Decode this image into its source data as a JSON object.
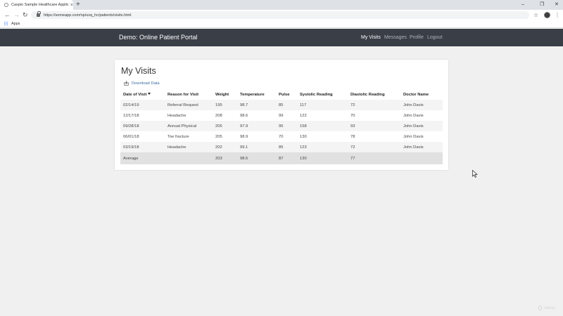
{
  "browser": {
    "tab_title": "Caspio Sample Healthcare Applic",
    "tab_close": "×",
    "new_tab": "+",
    "window_controls": [
      "–",
      "❐",
      "✕"
    ],
    "nav_back": "←",
    "nav_forward": "→",
    "nav_reload": "↻",
    "url": "https://someapp.com/np/uvq_hc/patients/visits.html",
    "bookmark_star": "☆",
    "menu": "⋮",
    "bookmarks": {
      "apps_label": "Apps"
    }
  },
  "navbar": {
    "brand": "Demo: Online Patient Portal",
    "links": [
      "My Visits",
      "Messages",
      "Profile",
      "Logout"
    ],
    "active": "My Visits"
  },
  "page": {
    "title": "My Visits",
    "download_label": "Download Data"
  },
  "table": {
    "columns": [
      "Date of Visit",
      "Reason for Visit",
      "Weight",
      "Temperature",
      "Pulse",
      "Systolic Reading",
      "Diastolic Reading",
      "Doctor Name"
    ],
    "rows": [
      [
        "02/14/19",
        "Referral Request",
        "195",
        "98.7",
        "85",
        "117",
        "72",
        "John Davis"
      ],
      [
        "12/17/18",
        "Headache",
        "208",
        "98.6",
        "99",
        "122",
        "70",
        "John Davis"
      ],
      [
        "09/28/18",
        "Annual Physical",
        "205",
        "97.9",
        "95",
        "158",
        "93",
        "John Davis"
      ],
      [
        "06/01/18",
        "Toe fracture",
        "205",
        "98.9",
        "70",
        "130",
        "78",
        "John Davis"
      ],
      [
        "03/19/18",
        "Headache",
        "202",
        "99.1",
        "85",
        "123",
        "72",
        "John Davis"
      ]
    ],
    "average": [
      "Average",
      "",
      "203",
      "98.6",
      "87",
      "130",
      "77",
      ""
    ]
  },
  "watermark": "Udemy",
  "colors": {
    "navbar_bg": "#3a3e47",
    "link": "#3b6ea5",
    "page_bg": "#f0f0f0",
    "alt_row": "#f4f4f4",
    "average_row": "#e1e1e1"
  },
  "icons": {
    "download": "download-icon",
    "sort": "sort-down-icon",
    "lock": "lock-icon",
    "apps": "apps-grid-icon"
  }
}
